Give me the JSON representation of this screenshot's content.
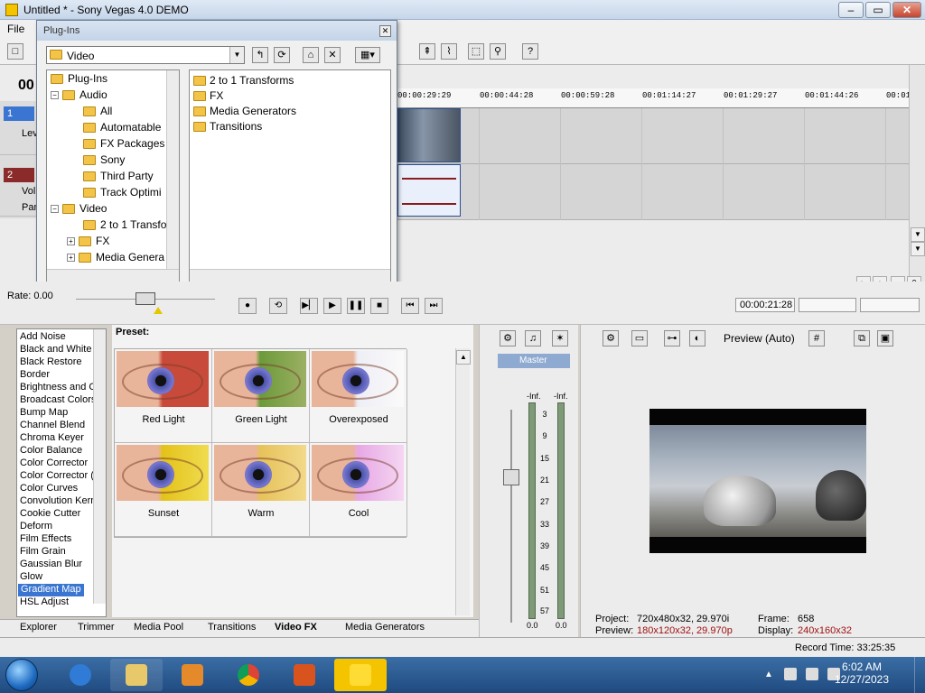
{
  "window": {
    "title": "Untitled * - Sony Vegas 4.0 DEMO",
    "min": "–",
    "max": "▭",
    "close": "✕"
  },
  "menu": {
    "file": "File"
  },
  "timeline": {
    "timecode_left": "00",
    "ruler": [
      "00:00:29:29",
      "00:00:44:28",
      "00:00:59:28",
      "00:01:14:27",
      "00:01:29:27",
      "00:01:44:26",
      "00:01"
    ],
    "tracks": [
      {
        "num": "1",
        "label": "Lev",
        "color": "#3a76d1"
      },
      {
        "num": "2",
        "label": "Vol",
        "label2": "Pan",
        "color": "#8b2a2a"
      }
    ]
  },
  "plugins": {
    "title": "Plug-Ins",
    "combo_value": "Video",
    "tree": [
      {
        "label": "Plug-Ins",
        "level": 0,
        "exp": ""
      },
      {
        "label": "Audio",
        "level": 1,
        "exp": "−"
      },
      {
        "label": "All",
        "level": 2,
        "exp": ""
      },
      {
        "label": "Automatable",
        "level": 2,
        "exp": ""
      },
      {
        "label": "FX Packages",
        "level": 2,
        "exp": ""
      },
      {
        "label": "Sony",
        "level": 2,
        "exp": ""
      },
      {
        "label": "Third Party",
        "level": 2,
        "exp": ""
      },
      {
        "label": "Track Optimi",
        "level": 2,
        "exp": ""
      },
      {
        "label": "Video",
        "level": 1,
        "exp": "−"
      },
      {
        "label": "2 to 1 Transfo",
        "level": 2,
        "exp": ""
      },
      {
        "label": "FX",
        "level": 2,
        "exp": "+"
      },
      {
        "label": "Media Genera",
        "level": 2,
        "exp": "+"
      }
    ],
    "list": [
      "2 to 1 Transforms",
      "FX",
      "Media Generators",
      "Transitions"
    ]
  },
  "transport": {
    "rate": "Rate: 0.00",
    "timecode": "00:00:21:28"
  },
  "fx_list": {
    "items": [
      "Add Noise",
      "Black and White",
      "Black Restore",
      "Border",
      "Brightness and C",
      "Broadcast Colors",
      "Bump Map",
      "Channel Blend",
      "Chroma Keyer",
      "Color Balance",
      "Color Corrector",
      "Color Corrector (S",
      "Color Curves",
      "Convolution Kern",
      "Cookie Cutter",
      "Deform",
      "Film Effects",
      "Film Grain",
      "Gaussian Blur",
      "Glow",
      "Gradient Map",
      "HSL Adjust"
    ],
    "selected": "Gradient Map"
  },
  "presets": {
    "label": "Preset:",
    "items": [
      {
        "name": "Red  Light",
        "tint": "#c84a3a"
      },
      {
        "name": "Green  Light",
        "tint": "#6c9a3a"
      },
      {
        "name": "Overexposed",
        "tint": "#eeeef6"
      },
      {
        "name": "Sunset",
        "tint": "#e4c21a"
      },
      {
        "name": "Warm",
        "tint": "#e6c25a"
      },
      {
        "name": "Cool",
        "tint": "#e7a8e4"
      }
    ]
  },
  "tabs": [
    "Explorer",
    "Trimmer",
    "Media Pool",
    "Transitions",
    "Video FX",
    "Media Generators"
  ],
  "active_tab": "Video FX",
  "mixer": {
    "master": "Master",
    "inf_left": "-Inf.",
    "inf_right": "-Inf.",
    "scale": [
      "3",
      "9",
      "15",
      "21",
      "27",
      "33",
      "39",
      "45",
      "51",
      "57"
    ],
    "bottom_left": "0.0",
    "bottom_right": "0.0"
  },
  "preview": {
    "mode": "Preview (Auto)",
    "project_label": "Project:",
    "project_value": "720x480x32, 29.970i",
    "preview_label": "Preview:",
    "preview_value": "180x120x32, 29.970p",
    "frame_label": "Frame:",
    "frame_value": "658",
    "display_label": "Display:",
    "display_value": "240x160x32"
  },
  "status": {
    "record_time": "Record Time: 33:25:35"
  },
  "taskbar": {
    "time": "6:02 AM",
    "date": "12/27/2023"
  }
}
